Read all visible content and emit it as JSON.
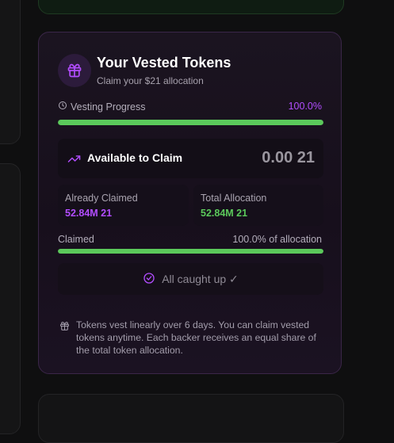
{
  "vesting_card": {
    "title": "Your Vested Tokens",
    "subtitle": "Claim your $21 allocation",
    "progress": {
      "label": "Vesting Progress",
      "percent_text": "100.0%",
      "fraction": 1.0
    },
    "available": {
      "label": "Available to Claim",
      "value": "0.00 21"
    },
    "stats": {
      "already_claimed": {
        "label": "Already Claimed",
        "value": "52.84M 21"
      },
      "total_allocation": {
        "label": "Total Allocation",
        "value": "52.84M 21"
      }
    },
    "claimed": {
      "label": "Claimed",
      "percent_text": "100.0% of allocation",
      "fraction": 1.0
    },
    "caught_up_button": {
      "label": "All caught up ✓"
    },
    "info": {
      "text": "Tokens vest linearly over 6 days. You can claim vested tokens anytime. Each backer receives an equal share of the total token allocation."
    }
  },
  "icons": {
    "header": "gift-icon",
    "progress": "clock-icon",
    "available": "trending-up-icon",
    "caught_up": "check-circle-icon",
    "info": "gift-icon"
  },
  "colors": {
    "accent_purple": "#b24dff",
    "progress_green": "#5bc95b",
    "card_border": "#3a2648"
  }
}
